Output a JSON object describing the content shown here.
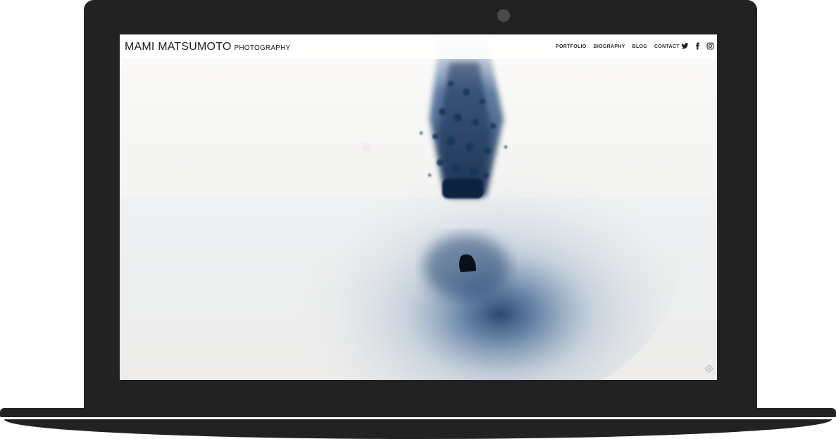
{
  "site": {
    "brand_name": "MAMI MATSUMOTO",
    "brand_sub": "PHOTOGRAPHY"
  },
  "nav": {
    "items": [
      {
        "label": "PORTFOLIO"
      },
      {
        "label": "BIOGRAPHY"
      },
      {
        "label": "BLOG"
      },
      {
        "label": "CONTACT"
      }
    ]
  },
  "social": {
    "icons": [
      "twitter-icon",
      "facebook-icon",
      "instagram-icon"
    ]
  },
  "colors": {
    "device_frame": "#222222",
    "header_text": "#1e1e1e",
    "photo_blue": "#1d3a63"
  }
}
